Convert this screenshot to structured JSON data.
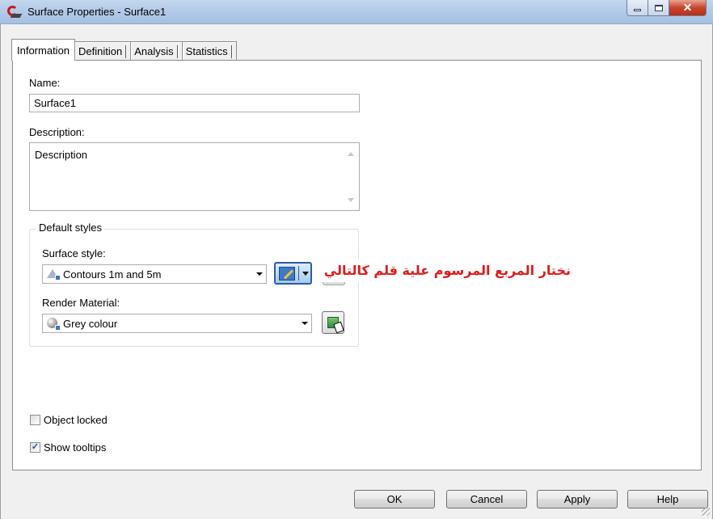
{
  "window": {
    "title": "Surface Properties - Surface1"
  },
  "tabs": [
    {
      "label": "Information",
      "active": true
    },
    {
      "label": "Definition",
      "active": false
    },
    {
      "label": "Analysis",
      "active": false
    },
    {
      "label": "Statistics",
      "active": false
    }
  ],
  "info": {
    "name_label": "Name:",
    "name_value": "Surface1",
    "description_label": "Description:",
    "description_value": "Description",
    "default_styles_title": "Default styles",
    "surface_style_label": "Surface style:",
    "surface_style_value": "Contours 1m and 5m",
    "render_material_label": "Render Material:",
    "render_material_value": "Grey colour",
    "annotation_text": "نختار المربع المرسوم علية قلم كالتالي",
    "object_locked_label": "Object locked",
    "object_locked_checked": false,
    "show_tooltips_label": "Show tooltips",
    "show_tooltips_checked": true
  },
  "buttons": {
    "ok": "OK",
    "cancel": "Cancel",
    "apply": "Apply",
    "help": "Help"
  },
  "colors": {
    "annotation": "#e11a1a",
    "title_bar": "#b3cbe8",
    "dialog_bg": "#f0f0f0"
  },
  "icons": [
    "app-icon",
    "minimize-icon",
    "maximize-icon",
    "close-icon",
    "surface-style-icon",
    "edit-style-icon",
    "render-material-icon",
    "pick-material-icon"
  ]
}
